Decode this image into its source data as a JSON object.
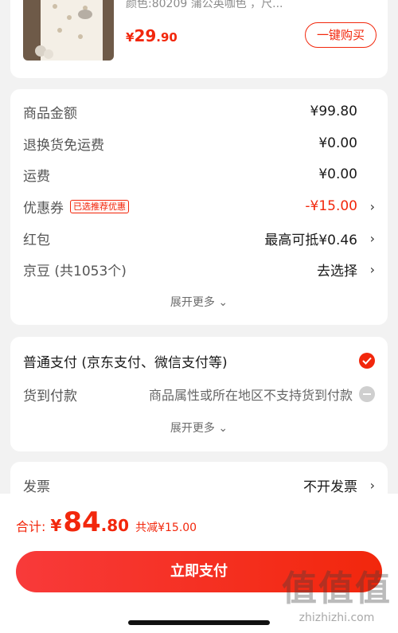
{
  "product": {
    "meta": "颜色:80209 蒲公英咖色 ，尺...",
    "price_currency": "¥",
    "price_int": "29",
    "price_dec": ".90",
    "buy_label": "一键购买"
  },
  "fees": {
    "rows": [
      {
        "label": "商品金额",
        "value": "¥99.80"
      },
      {
        "label": "退换货免运费",
        "value": "¥0.00"
      },
      {
        "label": "运费",
        "value": "¥0.00"
      },
      {
        "label": "优惠券",
        "tag": "已选推荐优惠",
        "value": "-¥15.00"
      },
      {
        "label": "红包",
        "value": "最高可抵¥0.46"
      },
      {
        "label": "京豆 (共1053个)",
        "value": "去选择"
      }
    ],
    "expand_label": "展开更多"
  },
  "payment": {
    "normal_label": "普通支付 (京东支付、微信支付等)",
    "cod_label": "货到付款",
    "cod_note": "商品属性或所在地区不支持货到付款",
    "expand_label": "展开更多"
  },
  "invoice": {
    "label": "发票",
    "value": "不开发票"
  },
  "bottom": {
    "total_label": "合计:",
    "currency": "¥",
    "total_int": "84",
    "total_dec": ".80",
    "saved": "共减¥15.00",
    "pay_label": "立即支付"
  },
  "watermark": {
    "big": "值值值",
    "small": "zhizhizhi.com"
  },
  "colors": {
    "accent": "#f2270c",
    "background": "#f2f2f2"
  }
}
